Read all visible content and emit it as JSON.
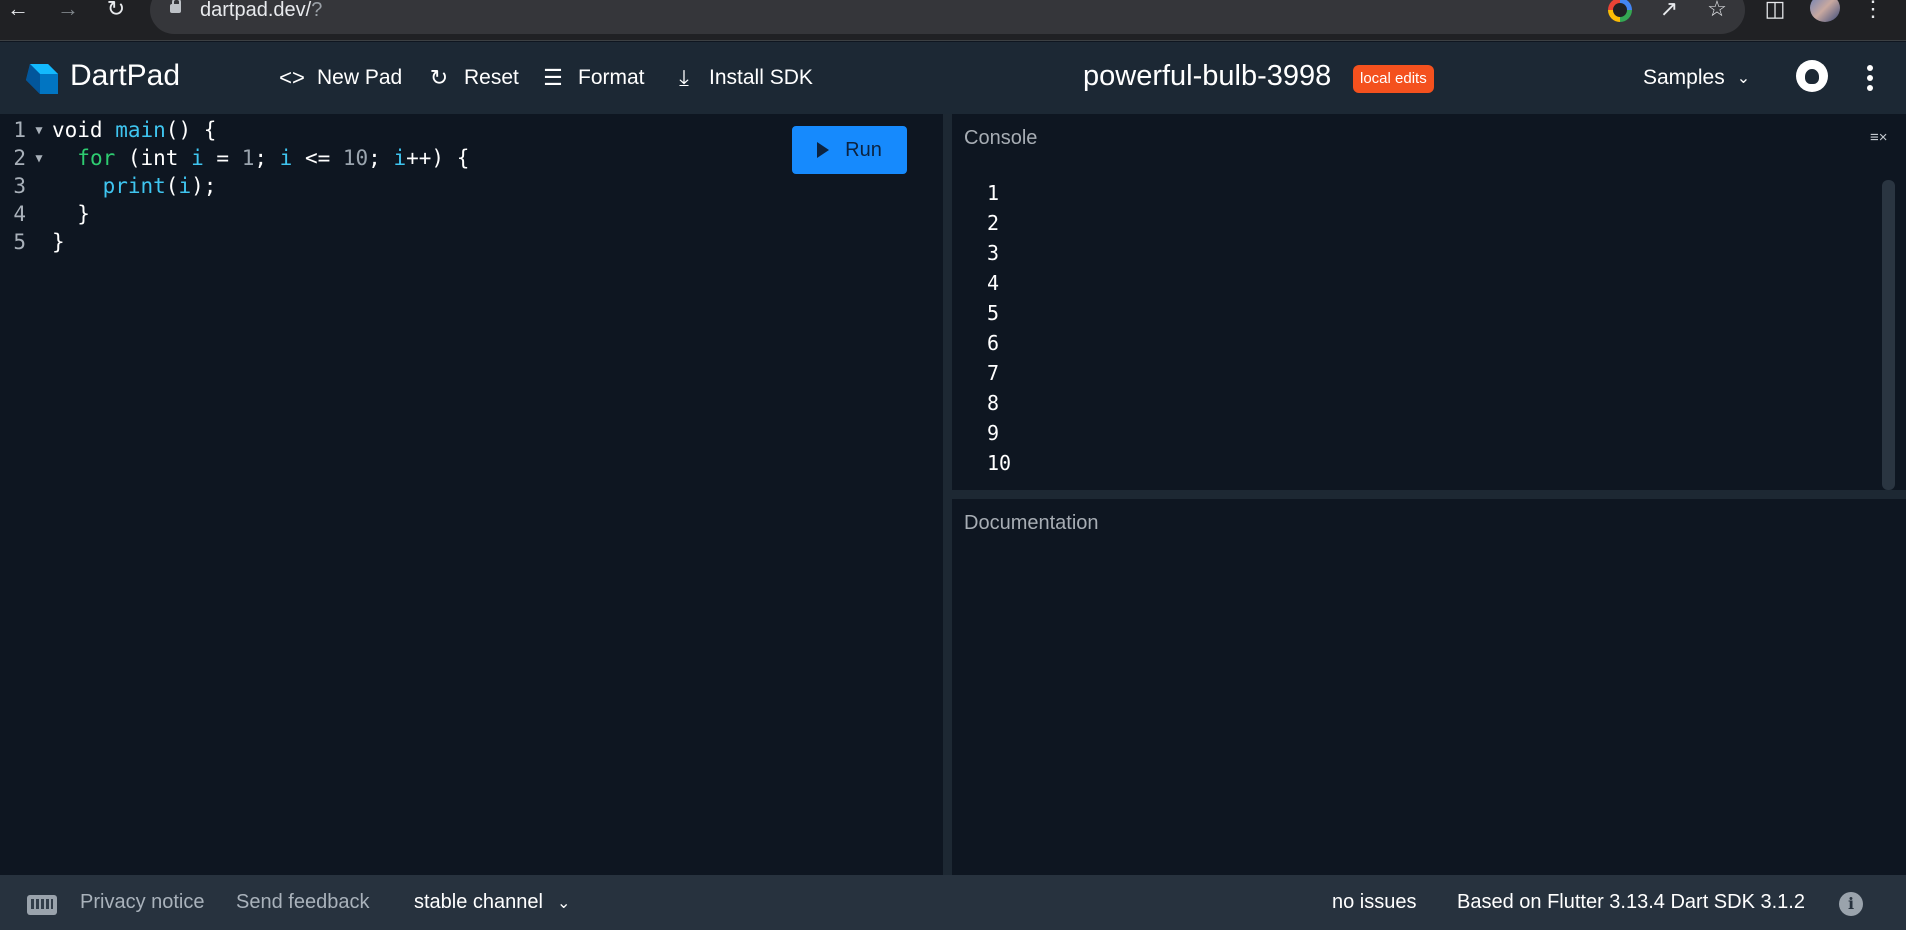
{
  "browser": {
    "url_host": "dartpad.dev/",
    "url_rest": "?"
  },
  "header": {
    "brand": "DartPad",
    "new_pad": "New Pad",
    "reset": "Reset",
    "format": "Format",
    "install_sdk": "Install SDK",
    "pad_name": "powerful-bulb-3998",
    "badge": "local edits",
    "samples": "Samples"
  },
  "editor": {
    "run_label": "Run",
    "line_numbers": [
      "1",
      "2",
      "3",
      "4",
      "5"
    ],
    "lines": [
      {
        "a": "void ",
        "b": "main",
        "c": "() {"
      },
      {
        "a": "  ",
        "b": "for",
        "c": " (int ",
        "d": "i",
        "e": " = ",
        "f": "1",
        "g": "; ",
        "h": "i",
        "i": " <= ",
        "j": "10",
        "k": "; ",
        "l": "i",
        "m": "++) {"
      },
      {
        "a": "    ",
        "b": "print",
        "c": "(",
        "d": "i",
        "e": ");"
      },
      {
        "a": "  }"
      },
      {
        "a": "}"
      }
    ]
  },
  "console": {
    "title": "Console",
    "output": [
      "1",
      "2",
      "3",
      "4",
      "5",
      "6",
      "7",
      "8",
      "9",
      "10"
    ]
  },
  "docs": {
    "title": "Documentation"
  },
  "footer": {
    "privacy": "Privacy notice",
    "feedback": "Send feedback",
    "channel": "stable channel",
    "issues": "no issues",
    "version": "Based on Flutter 3.13.4 Dart SDK 3.1.2"
  },
  "colors": {
    "run_button": "#168afd",
    "badge": "#f4511e",
    "keyword_fn": "#3fc5f0",
    "keyword_ctl": "#2ecc71"
  }
}
